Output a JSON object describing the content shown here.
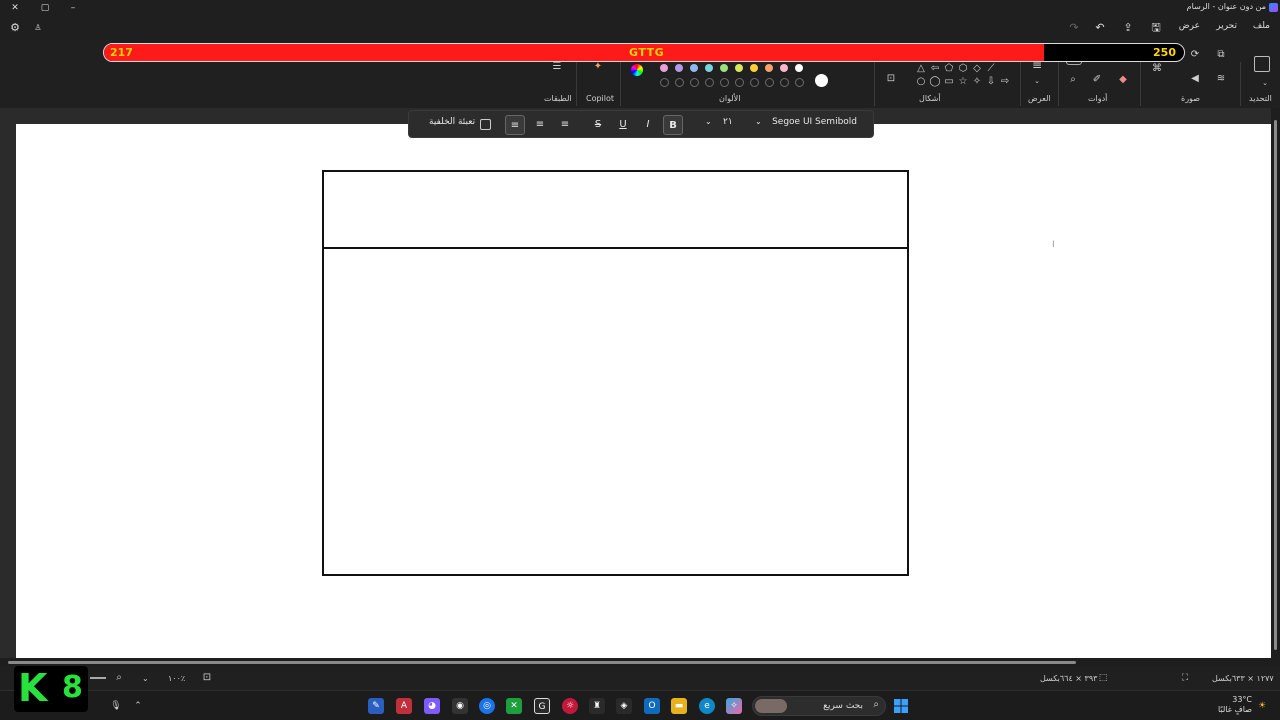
{
  "titlebar": {
    "title": "من دون عنوان - الرسام"
  },
  "menu": {
    "file": "ملف",
    "edit": "تحرير",
    "view": "عرض"
  },
  "overlay_bar": {
    "left_value": "217",
    "center_label": "GTTG",
    "right_value": "250",
    "fill_fraction": 0.87,
    "fill_color": "#ff1a1a"
  },
  "ribbon": {
    "groups": {
      "layers": "الطبقات",
      "copilot": "Copilot",
      "colors": "الألوان",
      "shapes": "أشكال",
      "size": "العرض",
      "tools": "أدوات",
      "image": "صورة",
      "selection": "التحديد"
    },
    "palette": [
      "#ffffff",
      "#ffb3c8",
      "#f7a06a",
      "#ffcc33",
      "#d8e85a",
      "#9be07c",
      "#7ad2e0",
      "#8fb6f0",
      "#b49ae6",
      "#e8a0d6"
    ]
  },
  "text_toolbar": {
    "font_name": "Segoe UI Semibold",
    "font_size": "٢١",
    "bold": "B",
    "italic": "I",
    "underline": "U",
    "strikethrough": "S",
    "fill_background": "تعبئة الخلفية"
  },
  "statusbar": {
    "zoom": "١٠٠٪",
    "canvas_size": "١٢٧٧ × ٦٣٣بكسل",
    "selection_size": "٣٩٣ × ٦٦٤بكسل"
  },
  "taskbar": {
    "search_placeholder": "بحث سريع",
    "temperature": "33°C",
    "weather_desc": "صافٍ غالبًا"
  },
  "logo": {
    "left": "K",
    "right": "8"
  }
}
